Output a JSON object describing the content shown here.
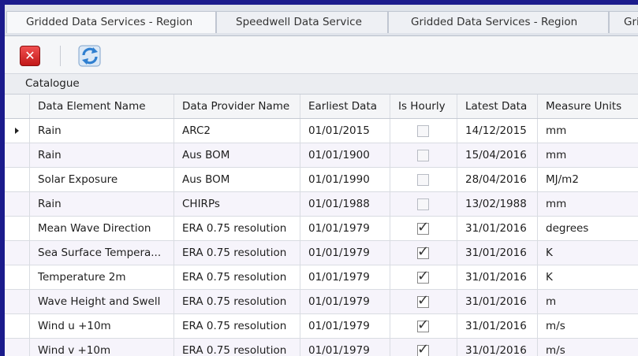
{
  "tabs": [
    {
      "label": "Gridded Data Services - Region"
    },
    {
      "label": "Speedwell Data Service"
    },
    {
      "label": "Gridded Data Services - Region"
    },
    {
      "label": "Gri"
    }
  ],
  "toolbar": {
    "close_icon": "close-icon",
    "refresh_icon": "refresh-icon"
  },
  "catalogue": {
    "title": "Catalogue"
  },
  "columns": [
    "Data Element Name",
    "Data Provider Name",
    "Earliest Data",
    "Is Hourly",
    "Latest Data",
    "Measure Units"
  ],
  "rows": [
    {
      "name": "Rain",
      "provider": "ARC2",
      "earliest": "01/01/2015",
      "hourly": false,
      "latest": "14/12/2015",
      "units": "mm",
      "current": true
    },
    {
      "name": "Rain",
      "provider": "Aus BOM",
      "earliest": "01/01/1900",
      "hourly": false,
      "latest": "15/04/2016",
      "units": "mm"
    },
    {
      "name": "Solar Exposure",
      "provider": "Aus BOM",
      "earliest": "01/01/1990",
      "hourly": false,
      "latest": "28/04/2016",
      "units": "MJ/m2"
    },
    {
      "name": "Rain",
      "provider": "CHIRPs",
      "earliest": "01/01/1988",
      "hourly": false,
      "latest": "13/02/1988",
      "units": "mm"
    },
    {
      "name": "Mean Wave Direction",
      "provider": "ERA 0.75 resolution",
      "earliest": "01/01/1979",
      "hourly": true,
      "latest": "31/01/2016",
      "units": "degrees"
    },
    {
      "name": "Sea Surface Tempera...",
      "provider": "ERA 0.75 resolution",
      "earliest": "01/01/1979",
      "hourly": true,
      "latest": "31/01/2016",
      "units": "K"
    },
    {
      "name": "Temperature 2m",
      "provider": "ERA 0.75 resolution",
      "earliest": "01/01/1979",
      "hourly": true,
      "latest": "31/01/2016",
      "units": "K"
    },
    {
      "name": "Wave Height and Swell",
      "provider": "ERA 0.75 resolution",
      "earliest": "01/01/1979",
      "hourly": true,
      "latest": "31/01/2016",
      "units": "m"
    },
    {
      "name": "Wind u +10m",
      "provider": "ERA 0.75 resolution",
      "earliest": "01/01/1979",
      "hourly": true,
      "latest": "31/01/2016",
      "units": "m/s"
    },
    {
      "name": "Wind v +10m",
      "provider": "ERA 0.75 resolution",
      "earliest": "01/01/1979",
      "hourly": true,
      "latest": "31/01/2016",
      "units": "m/s"
    }
  ]
}
